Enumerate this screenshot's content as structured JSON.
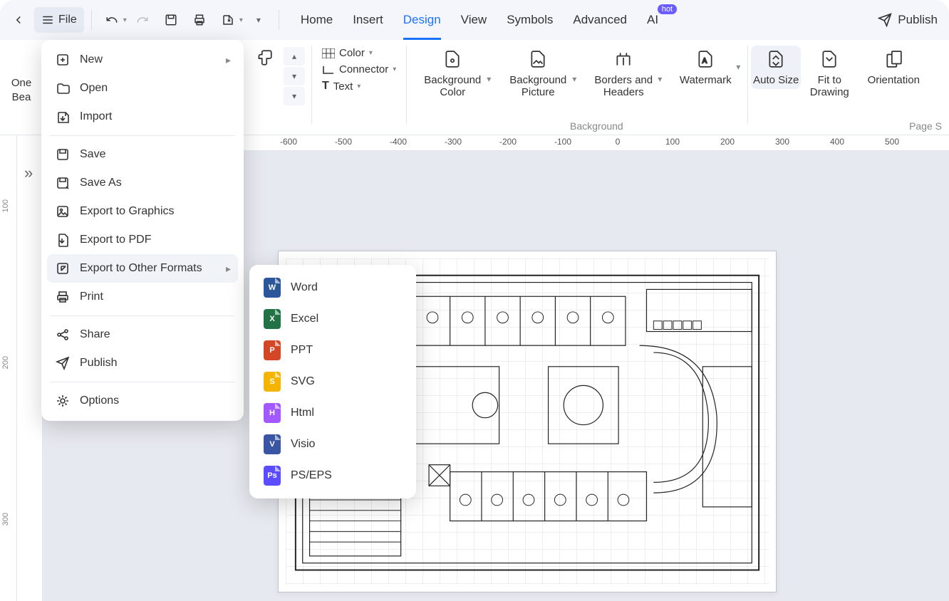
{
  "topbar": {
    "file_label": "File",
    "publish_label": "Publish"
  },
  "tabs": {
    "home": "Home",
    "insert": "Insert",
    "design": "Design",
    "view": "View",
    "symbols": "Symbols",
    "advanced": "Advanced",
    "ai": "AI",
    "hot_badge": "hot"
  },
  "ribbon": {
    "left_stub_line1": "One",
    "left_stub_line2": "Bea",
    "color": "Color",
    "connector": "Connector",
    "text": "Text",
    "bg_color": "Background Color",
    "bg_picture": "Background Picture",
    "borders": "Borders and Headers",
    "watermark": "Watermark",
    "auto_size": "Auto Size",
    "fit_to_drawing": "Fit to Drawing",
    "orientation": "Orientation",
    "section_background": "Background",
    "section_page": "Page S"
  },
  "ruler": {
    "h": [
      "-600",
      "-500",
      "-400",
      "-300",
      "-200",
      "-100",
      "0",
      "100",
      "200",
      "300",
      "400",
      "500"
    ],
    "v": [
      "100",
      "200",
      "300"
    ]
  },
  "file_menu": {
    "new": "New",
    "open": "Open",
    "import": "Import",
    "save": "Save",
    "save_as": "Save As",
    "export_graphics": "Export to Graphics",
    "export_pdf": "Export to PDF",
    "export_other": "Export to Other Formats",
    "print": "Print",
    "share": "Share",
    "publish": "Publish",
    "options": "Options"
  },
  "export_formats": {
    "word": "Word",
    "excel": "Excel",
    "ppt": "PPT",
    "svg": "SVG",
    "html": "Html",
    "visio": "Visio",
    "ps": "PS/EPS"
  }
}
